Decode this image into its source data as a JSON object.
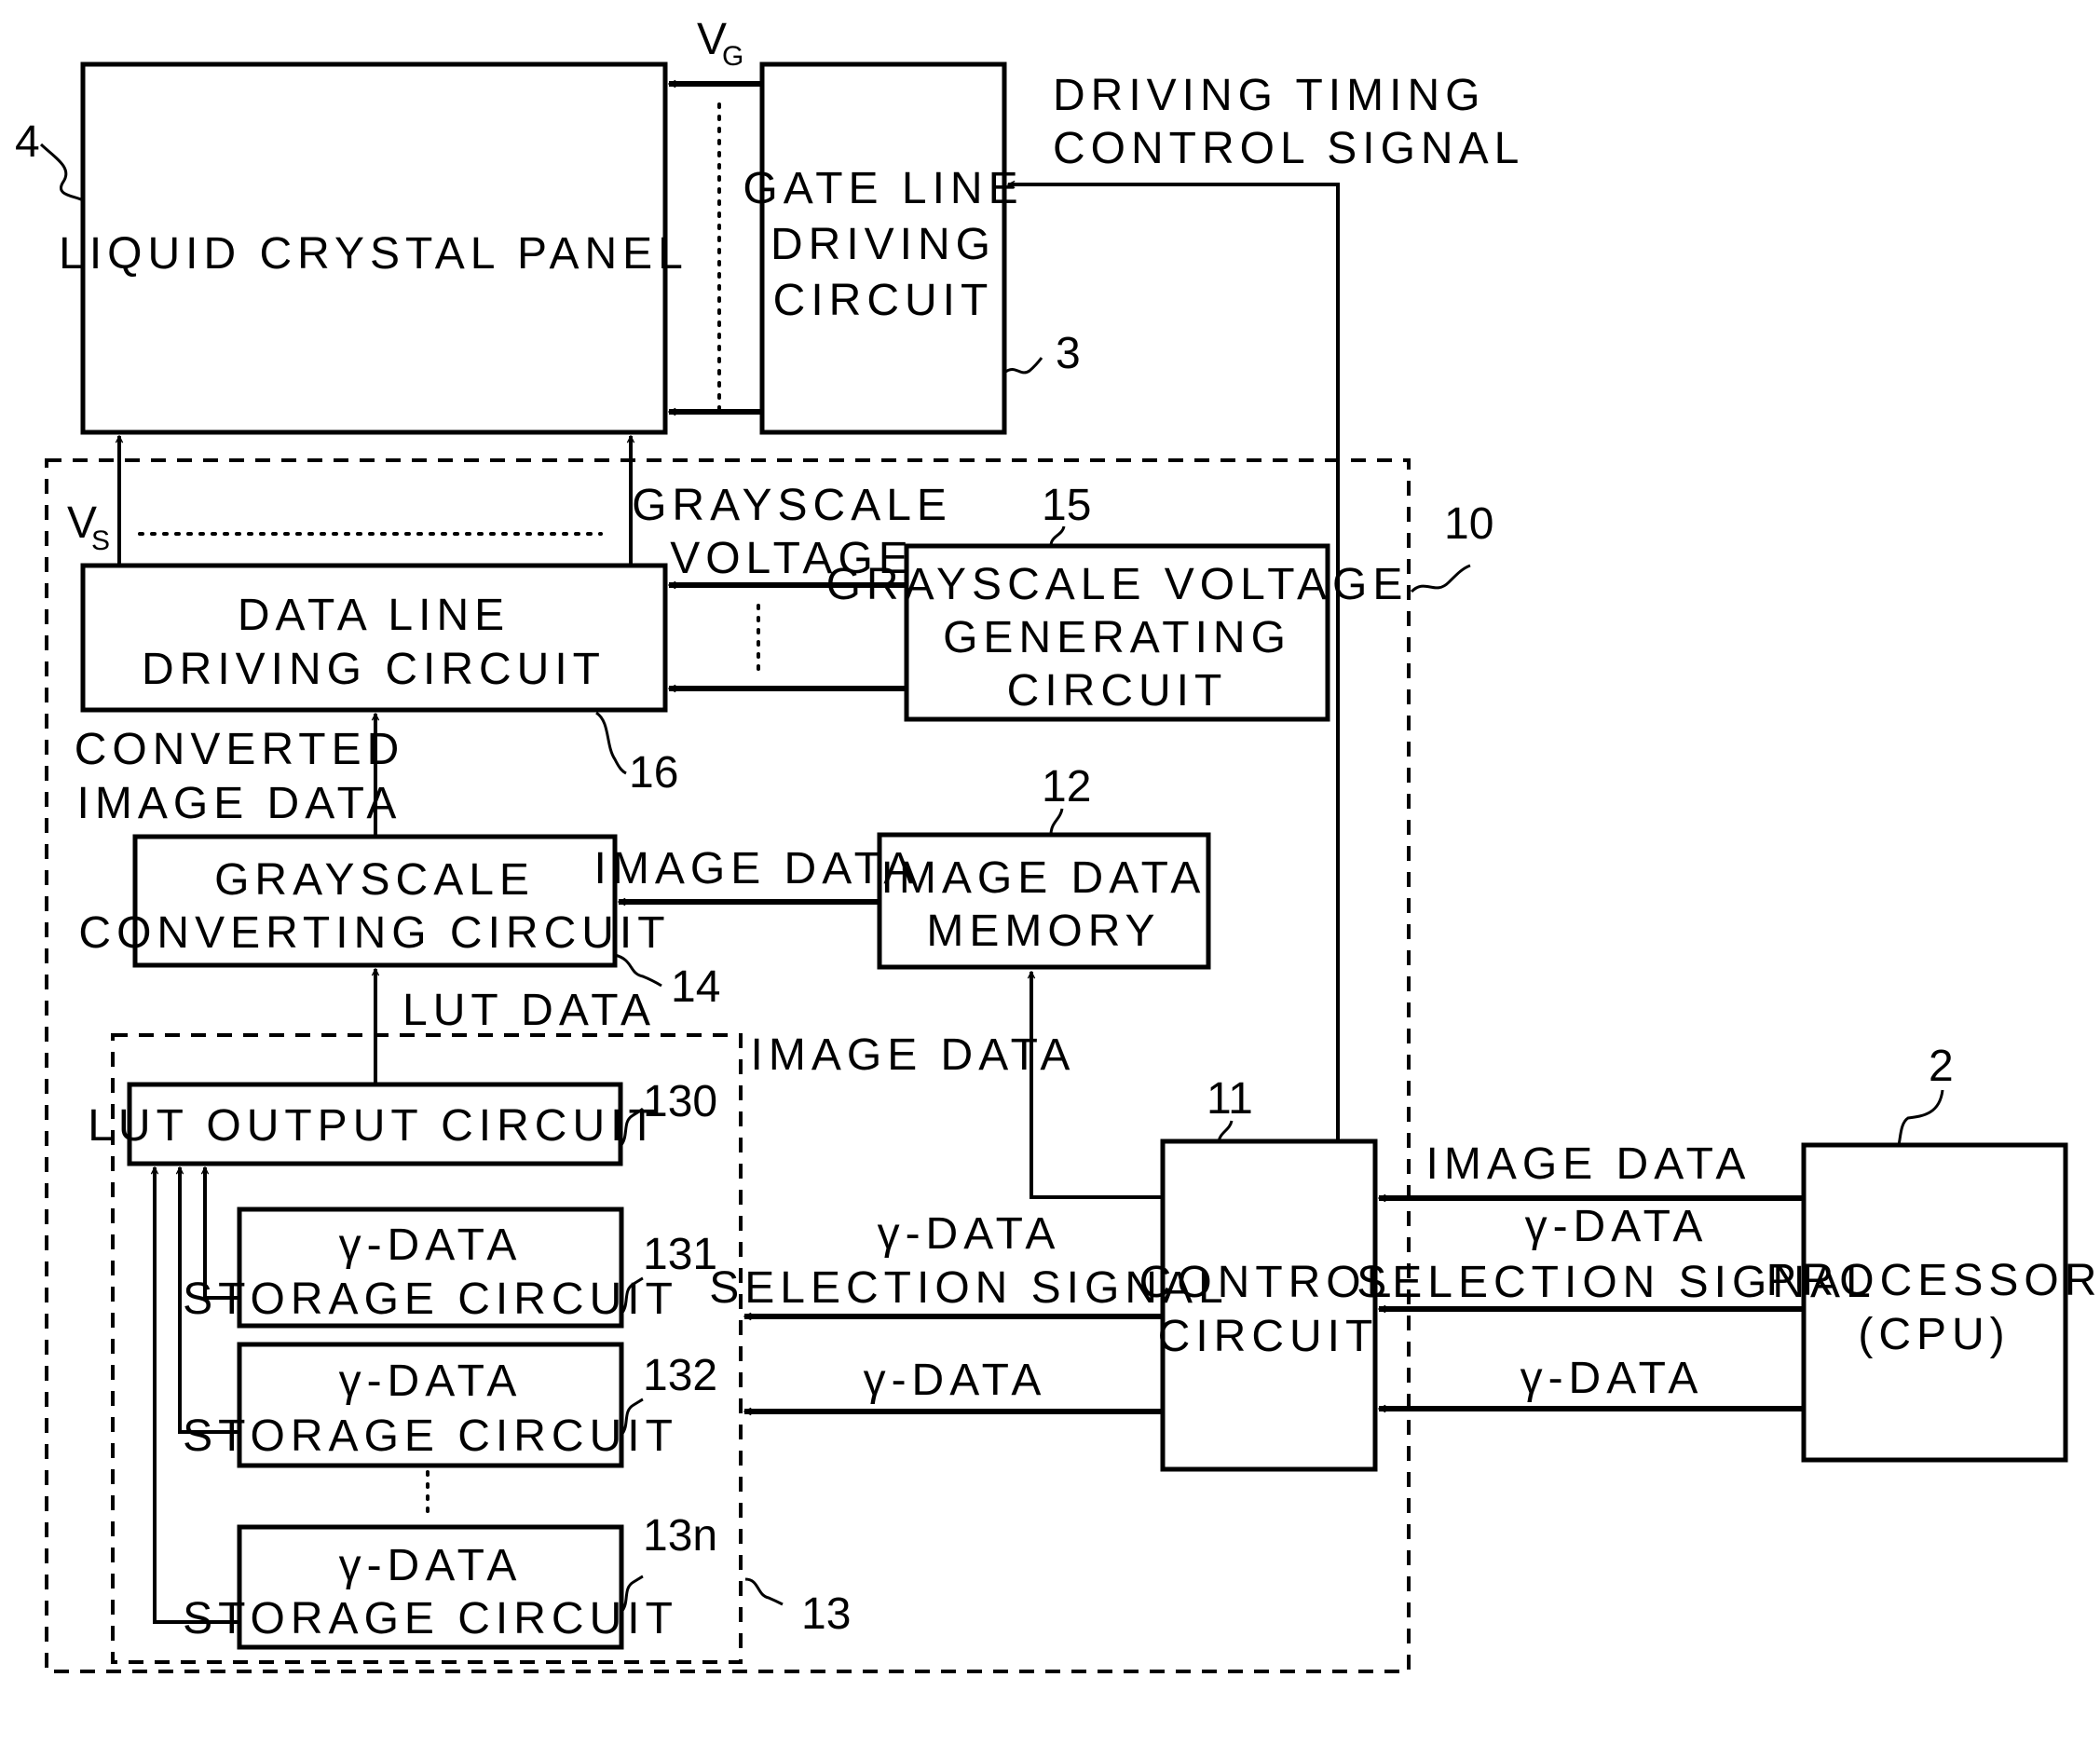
{
  "figure": {
    "blocks": {
      "lcd_panel": {
        "label": "LIQUID CRYSTAL PANEL",
        "ref": "4"
      },
      "gate_line": {
        "lines": [
          "GATE LINE",
          "DRIVING",
          "CIRCUIT"
        ],
        "ref": "3"
      },
      "controller": {
        "ref": "10"
      },
      "data_line": {
        "lines": [
          "DATA LINE",
          "DRIVING CIRCUIT"
        ],
        "ref": "16"
      },
      "grayscale_voltage_gen": {
        "lines": [
          "GRAYSCALE VOLTAGE",
          "GENERATING",
          "CIRCUIT"
        ],
        "ref": "15"
      },
      "grayscale_converting": {
        "lines": [
          "GRAYSCALE",
          "CONVERTING CIRCUIT"
        ],
        "ref": "14"
      },
      "image_data_memory": {
        "lines": [
          "IMAGE DATA",
          "MEMORY"
        ],
        "ref": "12"
      },
      "lut_group": {
        "ref": "13"
      },
      "lut_output": {
        "label": "LUT OUTPUT CIRCUIT",
        "ref": "130"
      },
      "gamma_storage": [
        {
          "lines": [
            "γ-DATA",
            "STORAGE CIRCUIT"
          ],
          "ref": "131"
        },
        {
          "lines": [
            "γ-DATA",
            "STORAGE CIRCUIT"
          ],
          "ref": "132"
        },
        {
          "lines": [
            "γ-DATA",
            "STORAGE CIRCUIT"
          ],
          "ref": "13n"
        }
      ],
      "control_circuit": {
        "lines": [
          "CONTROL",
          "CIRCUIT"
        ],
        "ref": "11"
      },
      "processor": {
        "lines": [
          "PROCESSOR",
          "(CPU)"
        ],
        "ref": "2"
      }
    },
    "signals": {
      "vg": {
        "main": "V",
        "sub": "G"
      },
      "vs": {
        "main": "V",
        "sub": "S"
      },
      "driving_timing": [
        "DRIVING TIMING",
        "CONTROL SIGNAL"
      ],
      "grayscale_voltage": [
        "GRAYSCALE",
        "VOLTAGE"
      ],
      "converted_image_data": [
        "CONVERTED",
        "IMAGE DATA"
      ],
      "image_data_to_converter": "IMAGE DATA",
      "lut_data": "LUT DATA",
      "image_data_to_memory": "IMAGE DATA",
      "sel_signal_left": [
        "γ-DATA",
        "SELECTION SIGNAL"
      ],
      "gamma_data_left": "γ-DATA",
      "image_data_cpu": "IMAGE DATA",
      "sel_signal_right": [
        "γ-DATA",
        "SELECTION SIGNAL"
      ],
      "gamma_data_right": "γ-DATA"
    }
  }
}
